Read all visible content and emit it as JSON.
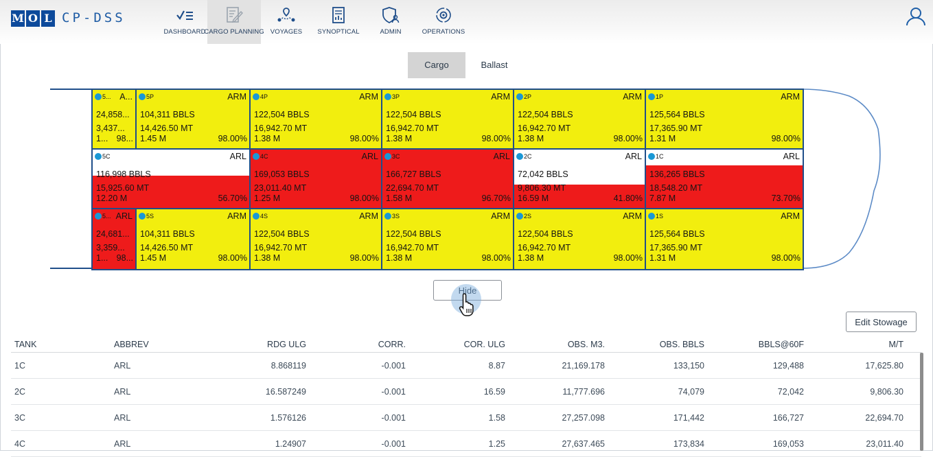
{
  "header": {
    "logo_letters": [
      "M",
      "O",
      "L"
    ],
    "app_title": "CP-DSS",
    "nav": [
      {
        "label": "DASHBOARD",
        "icon": "checklist-icon",
        "active": false
      },
      {
        "label": "CARGO PLANNING",
        "icon": "edit-document-icon",
        "active": true
      },
      {
        "label": "VOYAGES",
        "icon": "route-icon",
        "active": false
      },
      {
        "label": "SYNOPTICAL",
        "icon": "report-icon",
        "active": false
      },
      {
        "label": "ADMIN",
        "icon": "shield-user-icon",
        "active": false
      },
      {
        "label": "OPERATIONS",
        "icon": "gear-sync-icon",
        "active": false
      }
    ],
    "user_icon": "user-icon"
  },
  "toggle": {
    "cargo": "Cargo",
    "ballast": "Ballast",
    "selected": "Cargo"
  },
  "colors": {
    "yellow": "#f2ee0e",
    "red": "#ee1b1b",
    "white": "#ffffff",
    "border": "#1f4e8a",
    "dot": "#1a98d5"
  },
  "tanks": {
    "row1": [
      {
        "id": "5...",
        "grade": "A...",
        "bbls": "24,858...",
        "mt": "3,437...",
        "m": "1...",
        "pct": "98...",
        "color": "yellow",
        "fill": 1
      },
      {
        "id": "5P",
        "grade": "ARM",
        "bbls": "104,311 BBLS",
        "mt": "14,426.50 MT",
        "m": "1.45 M",
        "pct": "98.00%",
        "color": "yellow",
        "fill": 1
      },
      {
        "id": "4P",
        "grade": "ARM",
        "bbls": "122,504 BBLS",
        "mt": "16,942.70 MT",
        "m": "1.38 M",
        "pct": "98.00%",
        "color": "yellow",
        "fill": 1
      },
      {
        "id": "3P",
        "grade": "ARM",
        "bbls": "122,504 BBLS",
        "mt": "16,942.70 MT",
        "m": "1.38 M",
        "pct": "98.00%",
        "color": "yellow",
        "fill": 1
      },
      {
        "id": "2P",
        "grade": "ARM",
        "bbls": "122,504 BBLS",
        "mt": "16,942.70 MT",
        "m": "1.38 M",
        "pct": "98.00%",
        "color": "yellow",
        "fill": 1
      },
      {
        "id": "1P",
        "grade": "ARM",
        "bbls": "125,564 BBLS",
        "mt": "17,365.90 MT",
        "m": "1.31 M",
        "pct": "98.00%",
        "color": "yellow",
        "fill": 1
      }
    ],
    "row2": [
      {
        "id": "5C",
        "grade": "ARL",
        "bbls": "116,998 BBLS",
        "mt": "15,925.60 MT",
        "m": "12.20 M",
        "pct": "56.70%",
        "color": "red",
        "fill": 0.567
      },
      {
        "id": "4C",
        "grade": "ARL",
        "bbls": "169,053 BBLS",
        "mt": "23,011.40 MT",
        "m": "1.25 M",
        "pct": "98.00%",
        "color": "red",
        "fill": 1
      },
      {
        "id": "3C",
        "grade": "ARL",
        "bbls": "166,727 BBLS",
        "mt": "22,694.70 MT",
        "m": "1.58 M",
        "pct": "96.70%",
        "color": "red",
        "fill": 1
      },
      {
        "id": "2C",
        "grade": "ARL",
        "bbls": "72,042 BBLS",
        "mt": "9,806.30 MT",
        "m": "16.59 M",
        "pct": "41.80%",
        "color": "red",
        "fill": 0.418
      },
      {
        "id": "1C",
        "grade": "ARL",
        "bbls": "136,265 BBLS",
        "mt": "18,548.20 MT",
        "m": "7.87 M",
        "pct": "73.70%",
        "color": "red",
        "fill": 0.737
      }
    ],
    "row3": [
      {
        "id": "5...",
        "grade": "ARL",
        "bbls": "24,681...",
        "mt": "3,359...",
        "m": "1...",
        "pct": "98...",
        "color": "red",
        "fill": 1
      },
      {
        "id": "5S",
        "grade": "ARM",
        "bbls": "104,311 BBLS",
        "mt": "14,426.50 MT",
        "m": "1.45 M",
        "pct": "98.00%",
        "color": "yellow",
        "fill": 1
      },
      {
        "id": "4S",
        "grade": "ARM",
        "bbls": "122,504 BBLS",
        "mt": "16,942.70 MT",
        "m": "1.38 M",
        "pct": "98.00%",
        "color": "yellow",
        "fill": 1
      },
      {
        "id": "3S",
        "grade": "ARM",
        "bbls": "122,504 BBLS",
        "mt": "16,942.70 MT",
        "m": "1.38 M",
        "pct": "98.00%",
        "color": "yellow",
        "fill": 1
      },
      {
        "id": "2S",
        "grade": "ARM",
        "bbls": "122,504 BBLS",
        "mt": "16,942.70 MT",
        "m": "1.38 M",
        "pct": "98.00%",
        "color": "yellow",
        "fill": 1
      },
      {
        "id": "1S",
        "grade": "ARM",
        "bbls": "125,564 BBLS",
        "mt": "17,365.90 MT",
        "m": "1.31 M",
        "pct": "98.00%",
        "color": "yellow",
        "fill": 1
      }
    ]
  },
  "buttons": {
    "hide": "Hide",
    "edit_stowage": "Edit Stowage"
  },
  "table": {
    "headers": [
      "TANK",
      "ABBREV",
      "RDG ULG",
      "CORR.",
      "COR. ULG",
      "OBS. M3.",
      "OBS. BBLS",
      "BBLS@60F",
      "M/T"
    ],
    "rows": [
      [
        "1C",
        "ARL",
        "8.868119",
        "-0.001",
        "8.87",
        "21,169.178",
        "133,150",
        "129,488",
        "17,625.80"
      ],
      [
        "2C",
        "ARL",
        "16.587249",
        "-0.001",
        "16.59",
        "11,777.696",
        "74,079",
        "72,042",
        "9,806.30"
      ],
      [
        "3C",
        "ARL",
        "1.576126",
        "-0.001",
        "1.58",
        "27,257.098",
        "171,442",
        "166,727",
        "22,694.70"
      ],
      [
        "4C",
        "ARL",
        "1.24907",
        "-0.001",
        "1.25",
        "27,637.465",
        "173,834",
        "169,053",
        "23,011.40"
      ]
    ]
  }
}
